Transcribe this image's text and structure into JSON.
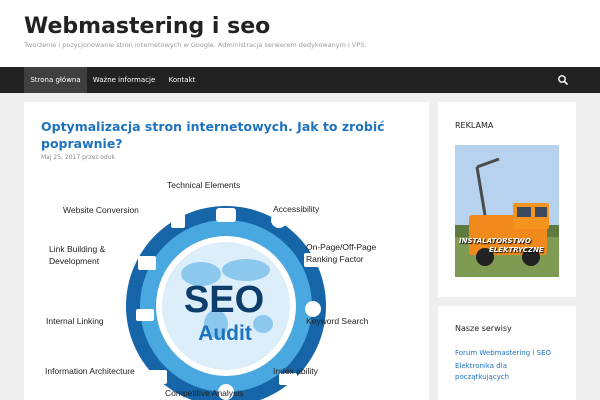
{
  "site": {
    "title": "Webmastering i seo",
    "description": "Tworzenie i pozycjonowanie stron internetowych w Google. Administracja serwerem dedykowanym i VPS."
  },
  "nav": {
    "items": [
      {
        "label": "Strona główna",
        "active": true
      },
      {
        "label": "Ważne informacje",
        "active": false
      },
      {
        "label": "Kontakt",
        "active": false
      }
    ],
    "search_icon": "search-icon"
  },
  "post": {
    "title": "Optymalizacja stron internetowych. Jak to zrobić poprawnie?",
    "date": "Maj 25, 2017",
    "by": "przez",
    "author": "oduk"
  },
  "seo_image": {
    "center_top": "SEO",
    "center_bottom": "Audit",
    "labels": [
      "Technical Elements",
      "Accessibility",
      "On-Page/Off-Page",
      "Ranking Factor",
      "Keyword Search",
      "Index ability",
      "Competitive Analysis",
      "Information Architecture",
      "Internal Linking",
      "Link Building &",
      "Development",
      "Website Conversion"
    ],
    "colors": {
      "ring_dark": "#1565a8",
      "ring_light": "#4aa8e0",
      "center": "#dbeefa",
      "text_dark": "#0d3d6b"
    }
  },
  "sidebar": {
    "ad_title": "REKLAMA",
    "ad_caption_1": "INSTALATORSTWO",
    "ad_caption_2": "ELEKTRYCZNE",
    "services_title": "Nasze serwisy",
    "links": [
      "Forum Webmastering i SEO",
      "Elektronika dla",
      "początkujących"
    ]
  },
  "colors": {
    "link": "#1e73be",
    "nav_bg": "#222222",
    "page_bg": "#efefef"
  }
}
